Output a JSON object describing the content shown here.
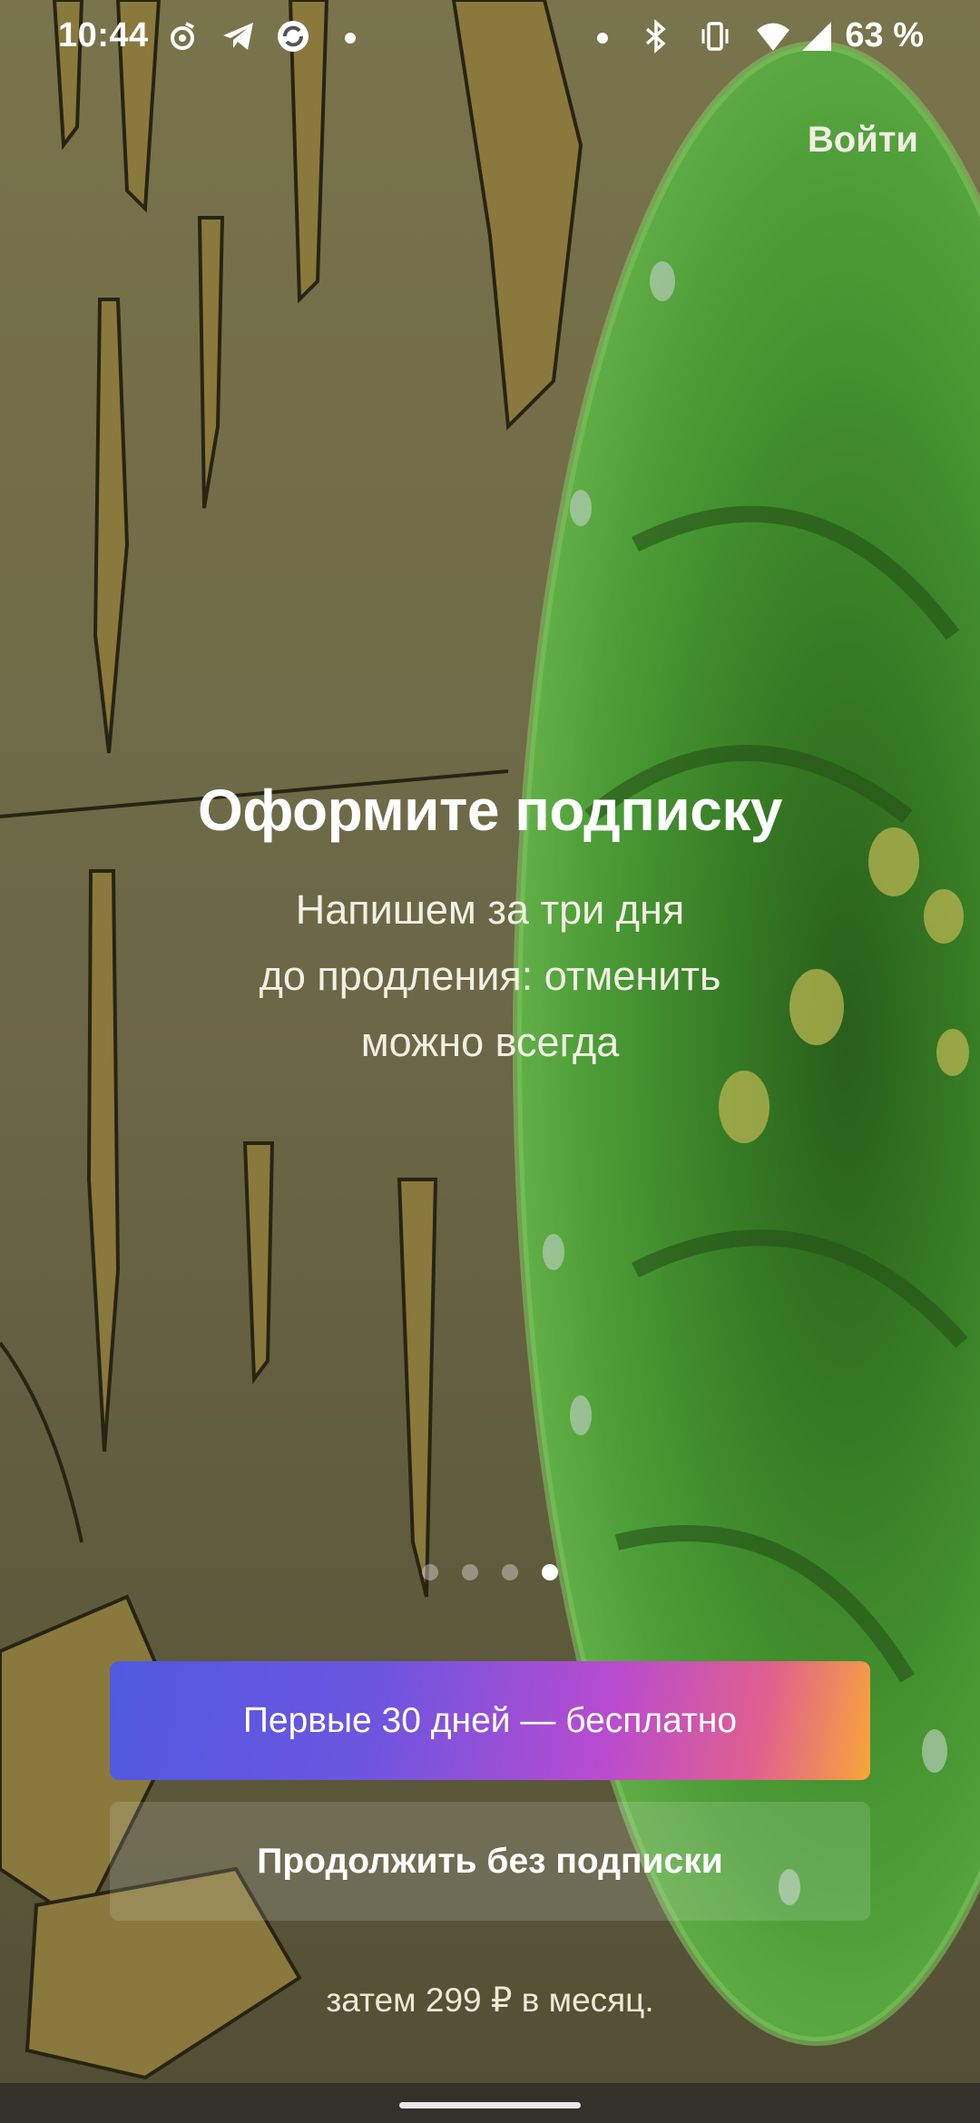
{
  "status_bar": {
    "time": "10:44",
    "battery": "63 %",
    "left_icons": [
      "music-note-icon",
      "telegram-icon",
      "sync-app-icon",
      "dot-icon"
    ],
    "right_icons": [
      "dot-icon",
      "bluetooth-icon",
      "vibrate-icon",
      "wifi-icon",
      "signal-icon"
    ]
  },
  "header": {
    "login_label": "Войти"
  },
  "hero": {
    "title": "Оформите подписку",
    "subtitle_line1": "Напишем за три дня",
    "subtitle_line2": "до продления: отменить",
    "subtitle_line3": "можно всегда"
  },
  "pager": {
    "total": 4,
    "active_index": 4
  },
  "actions": {
    "primary_label": "Первые 30 дней — бесплатно",
    "secondary_label": "Продолжить без подписки",
    "price_note": "затем 299 ₽ в месяц."
  },
  "colors": {
    "primary_gradient_start": "#4f5ae0",
    "primary_gradient_end": "#f8a63a",
    "background_olive": "#6f6a45",
    "portal_green": "#4fae3a"
  }
}
